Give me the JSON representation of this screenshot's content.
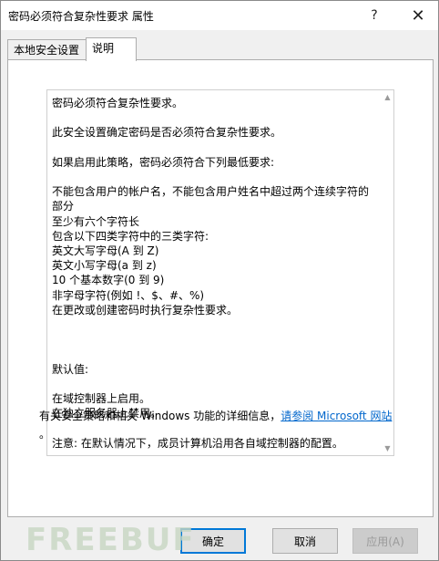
{
  "window": {
    "title": "密码必须符合复杂性要求 属性",
    "help_button": "?",
    "close_button": "✕"
  },
  "tabs": [
    {
      "label": "本地安全设置"
    },
    {
      "label": "说明"
    }
  ],
  "explain": {
    "lines": [
      "密码必须符合复杂性要求。",
      "",
      "此安全设置确定密码是否必须符合复杂性要求。",
      "",
      "如果启用此策略，密码必须符合下列最低要求:",
      "",
      "不能包含用户的帐户名，不能包含用户姓名中超过两个连续字符的部分",
      "至少有六个字符长",
      "包含以下四类字符中的三类字符:",
      "英文大写字母(A 到 Z)",
      "英文小写字母(a 到 z)",
      "10 个基本数字(0 到 9)",
      "非字母字符(例如 !、$、#、%)",
      "在更改或创建密码时执行复杂性要求。",
      "",
      "",
      "",
      "默认值:",
      "",
      "在域控制器上启用。",
      "在独立服务器上禁用。",
      "",
      "注意: 在默认情况下，成员计算机沿用各自域控制器的配置。"
    ]
  },
  "info": {
    "text": "有关安全策略和相关 Windows 功能的详细信息，",
    "link": "请参阅 Microsoft 网站",
    "period": "。"
  },
  "buttons": {
    "ok": "确定",
    "cancel": "取消",
    "apply": "应用(A)"
  },
  "watermark": "FREEBUF"
}
